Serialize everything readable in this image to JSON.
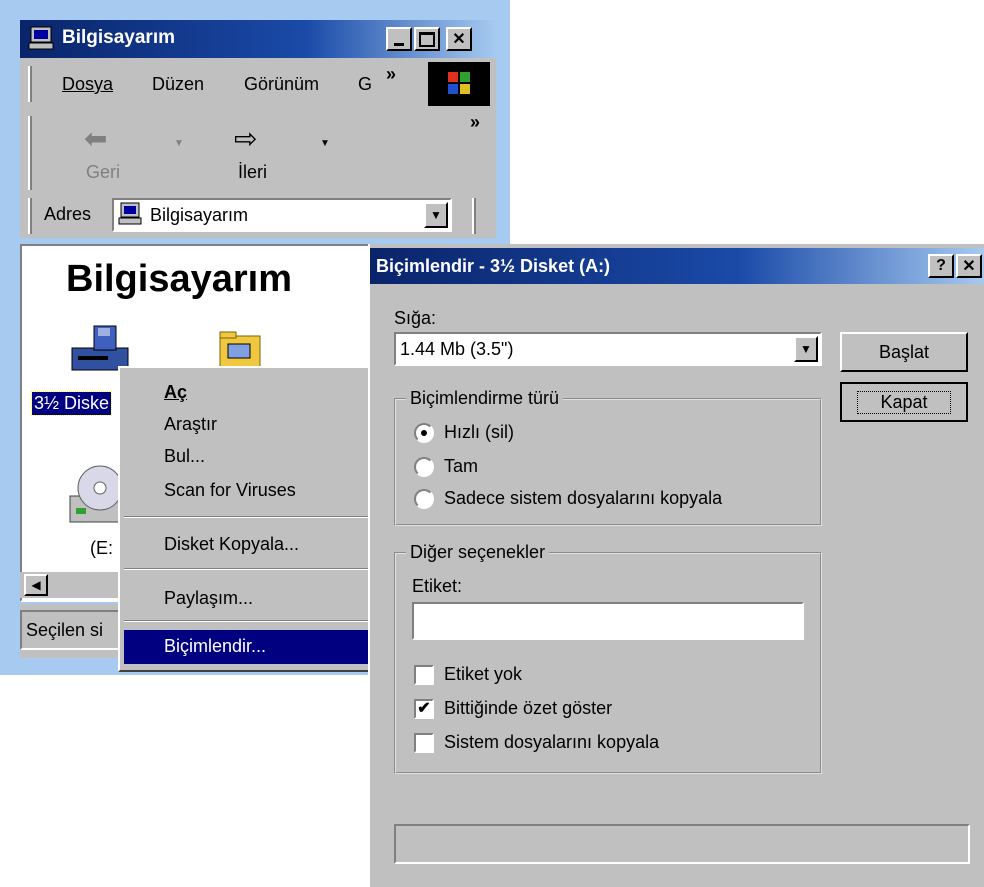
{
  "explorer": {
    "title": "Bilgisayarım",
    "menu": [
      "Dosya",
      "Düzen",
      "Görünüm",
      "G"
    ],
    "menu_overflow": "»",
    "toolbar_overflow": "»",
    "back_label": "Geri",
    "forward_label": "İleri",
    "address_label": "Adres",
    "address_value": "Bilgisayarım",
    "content_heading": "Bilgisayarım",
    "icons": {
      "floppy_label": "3½ Diske",
      "cd_label": "(E:"
    },
    "status_text": "Seçilen si"
  },
  "context_menu": {
    "items": [
      "Aç",
      "Araştır",
      "Bul...",
      "Scan for Viruses",
      "Disket Kopyala...",
      "Paylaşım...",
      "Biçimlendir..."
    ],
    "default_item": "Aç",
    "selected_item": "Biçimlendir..."
  },
  "format_dialog": {
    "title": "Biçimlendir - 3½ Disket (A:)",
    "capacity_label": "Sığa:",
    "capacity_value": "1.44 Mb (3.5\")",
    "start_button": "Başlat",
    "close_button": "Kapat",
    "format_type_group": "Biçimlendirme türü",
    "format_types": [
      {
        "label": "Hızlı (sil)",
        "selected": true
      },
      {
        "label": "Tam",
        "selected": false
      },
      {
        "label": "Sadece sistem dosyalarını kopyala",
        "selected": false
      }
    ],
    "other_options_group": "Diğer seçenekler",
    "label_field_label": "Etiket:",
    "label_field_value": "",
    "checkboxes": [
      {
        "label": "Etiket yok",
        "checked": false
      },
      {
        "label": "Bittiğinde özet göster",
        "checked": true
      },
      {
        "label": "Sistem dosyalarını kopyala",
        "checked": false
      }
    ],
    "progress_percent": 0
  },
  "colors": {
    "window_gray": "#c0c0c0",
    "title_blue": "#0a246a",
    "selection_blue": "#000080",
    "desktop_blue": "#a6caf0"
  }
}
